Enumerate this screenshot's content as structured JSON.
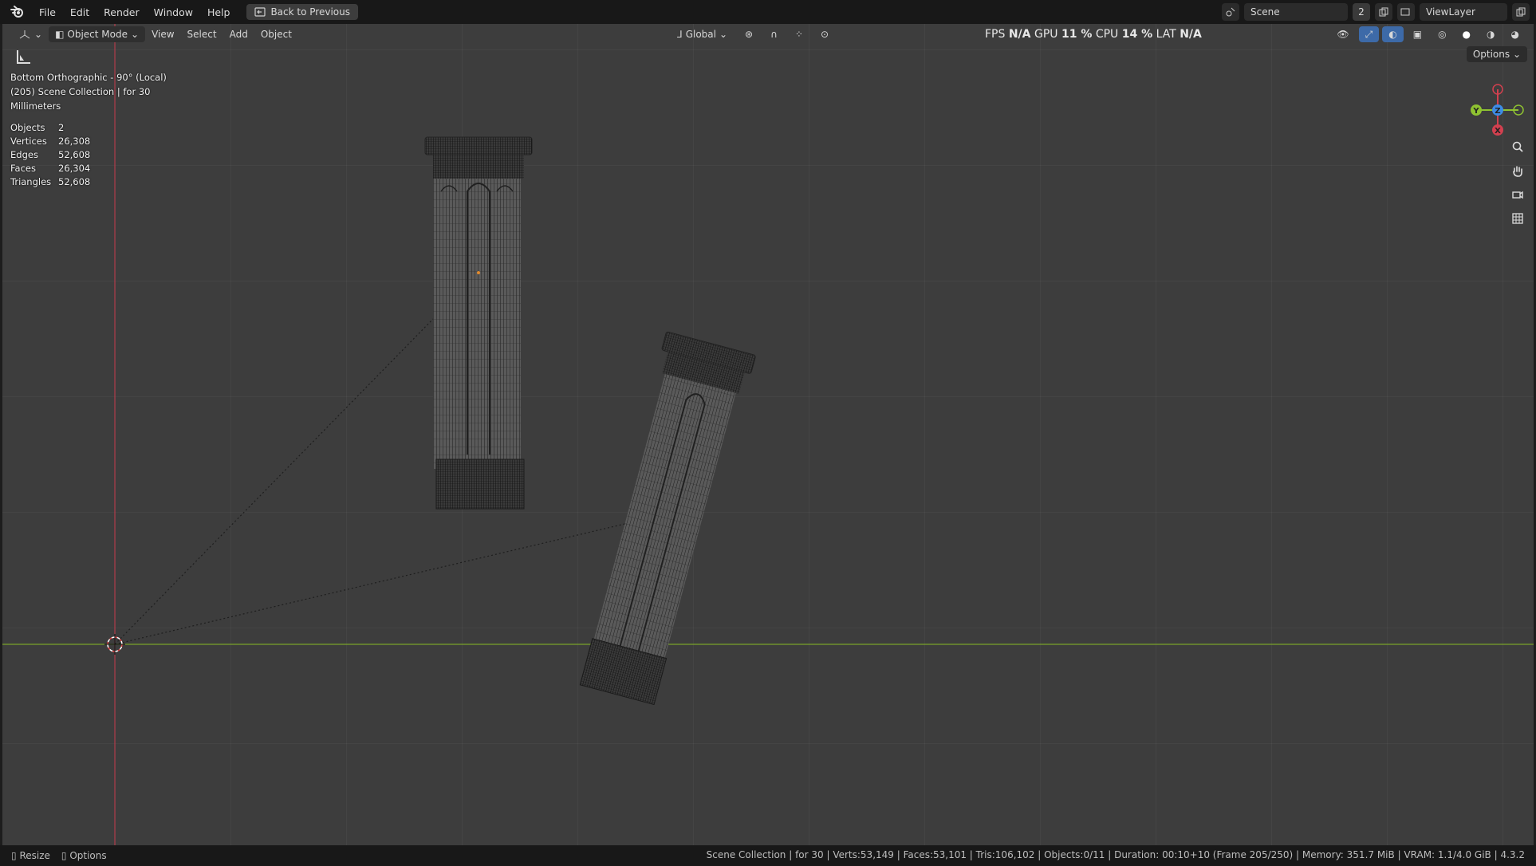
{
  "menubar": {
    "items": [
      "File",
      "Edit",
      "Render",
      "Window",
      "Help"
    ],
    "back_button": "Back to Previous",
    "scene_name": "Scene",
    "scene_count": "2",
    "view_layer": "ViewLayer"
  },
  "header": {
    "mode": "Object Mode",
    "menus": [
      "View",
      "Select",
      "Add",
      "Object"
    ],
    "orientation": "Global",
    "options": "Options"
  },
  "perf": {
    "fps_label": "FPS",
    "fps_value": "N/A",
    "gpu_label": "GPU",
    "gpu_value": "11 %",
    "cpu_label": "CPU",
    "cpu_value": "14 %",
    "lat_label": "LAT",
    "lat_value": "N/A"
  },
  "viewport_info": {
    "view": "Bottom Orthographic - 90° (Local)",
    "collection": "(205) Scene Collection | for 30",
    "units": "Millimeters"
  },
  "stats": [
    {
      "label": "Objects",
      "value": "2"
    },
    {
      "label": "Vertices",
      "value": "26,308"
    },
    {
      "label": "Edges",
      "value": "52,608"
    },
    {
      "label": "Faces",
      "value": "26,304"
    },
    {
      "label": "Triangles",
      "value": "52,608"
    }
  ],
  "gizmo": {
    "y": "Y",
    "z": "Z",
    "x": "X"
  },
  "statusbar": {
    "left": [
      "Resize",
      "Options"
    ],
    "right": "Scene Collection | for 30 | Verts:53,149 | Faces:53,101 | Tris:106,102 | Objects:0/11 | Duration: 00:10+10 (Frame 205/250) | Memory: 351.7 MiB | VRAM: 1.1/4.0 GiB | 4.3.2"
  },
  "colors": {
    "x_axis": "#d2404f",
    "y_axis": "#8fc231",
    "z_axis": "#3d8ce6",
    "viewport_bg": "#3d3d3d"
  }
}
